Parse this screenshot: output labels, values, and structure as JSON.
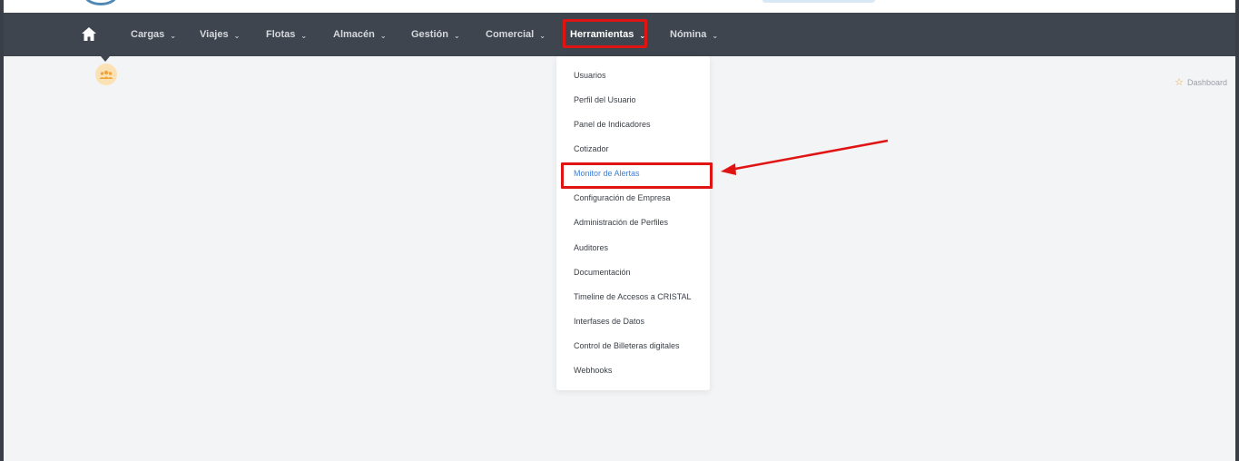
{
  "nav": {
    "items": [
      {
        "label": "Cargas"
      },
      {
        "label": "Viajes"
      },
      {
        "label": "Flotas"
      },
      {
        "label": "Almacén"
      },
      {
        "label": "Gestión"
      },
      {
        "label": "Comercial"
      },
      {
        "label": "Herramientas",
        "active": true
      },
      {
        "label": "Nómina"
      }
    ]
  },
  "breadcrumb": {
    "label": "Dashboard"
  },
  "dropdown": {
    "items": [
      {
        "label": "Usuarios"
      },
      {
        "label": "Perfil del Usuario"
      },
      {
        "label": "Panel de Indicadores"
      },
      {
        "label": "Cotizador"
      },
      {
        "label": "Monitor de Alertas",
        "active": true
      },
      {
        "label": "Configuración de Empresa"
      },
      {
        "label": "Administración de Perfiles"
      },
      {
        "label": "Auditores"
      },
      {
        "label": "Documentación"
      },
      {
        "label": "Timeline de Accesos a CRISTAL"
      },
      {
        "label": "Interfases de Datos"
      },
      {
        "label": "Control de Billeteras digitales"
      },
      {
        "label": "Webhooks"
      }
    ]
  },
  "icons": {
    "home": "home-icon",
    "chevron": "chevron-down-icon",
    "star": "star-icon",
    "user": "user-group-icon"
  },
  "colors": {
    "navbar": "#3f454e",
    "highlight": "#e11414",
    "active_link": "#3f7fd6",
    "avatar": "#fbe2b5"
  }
}
